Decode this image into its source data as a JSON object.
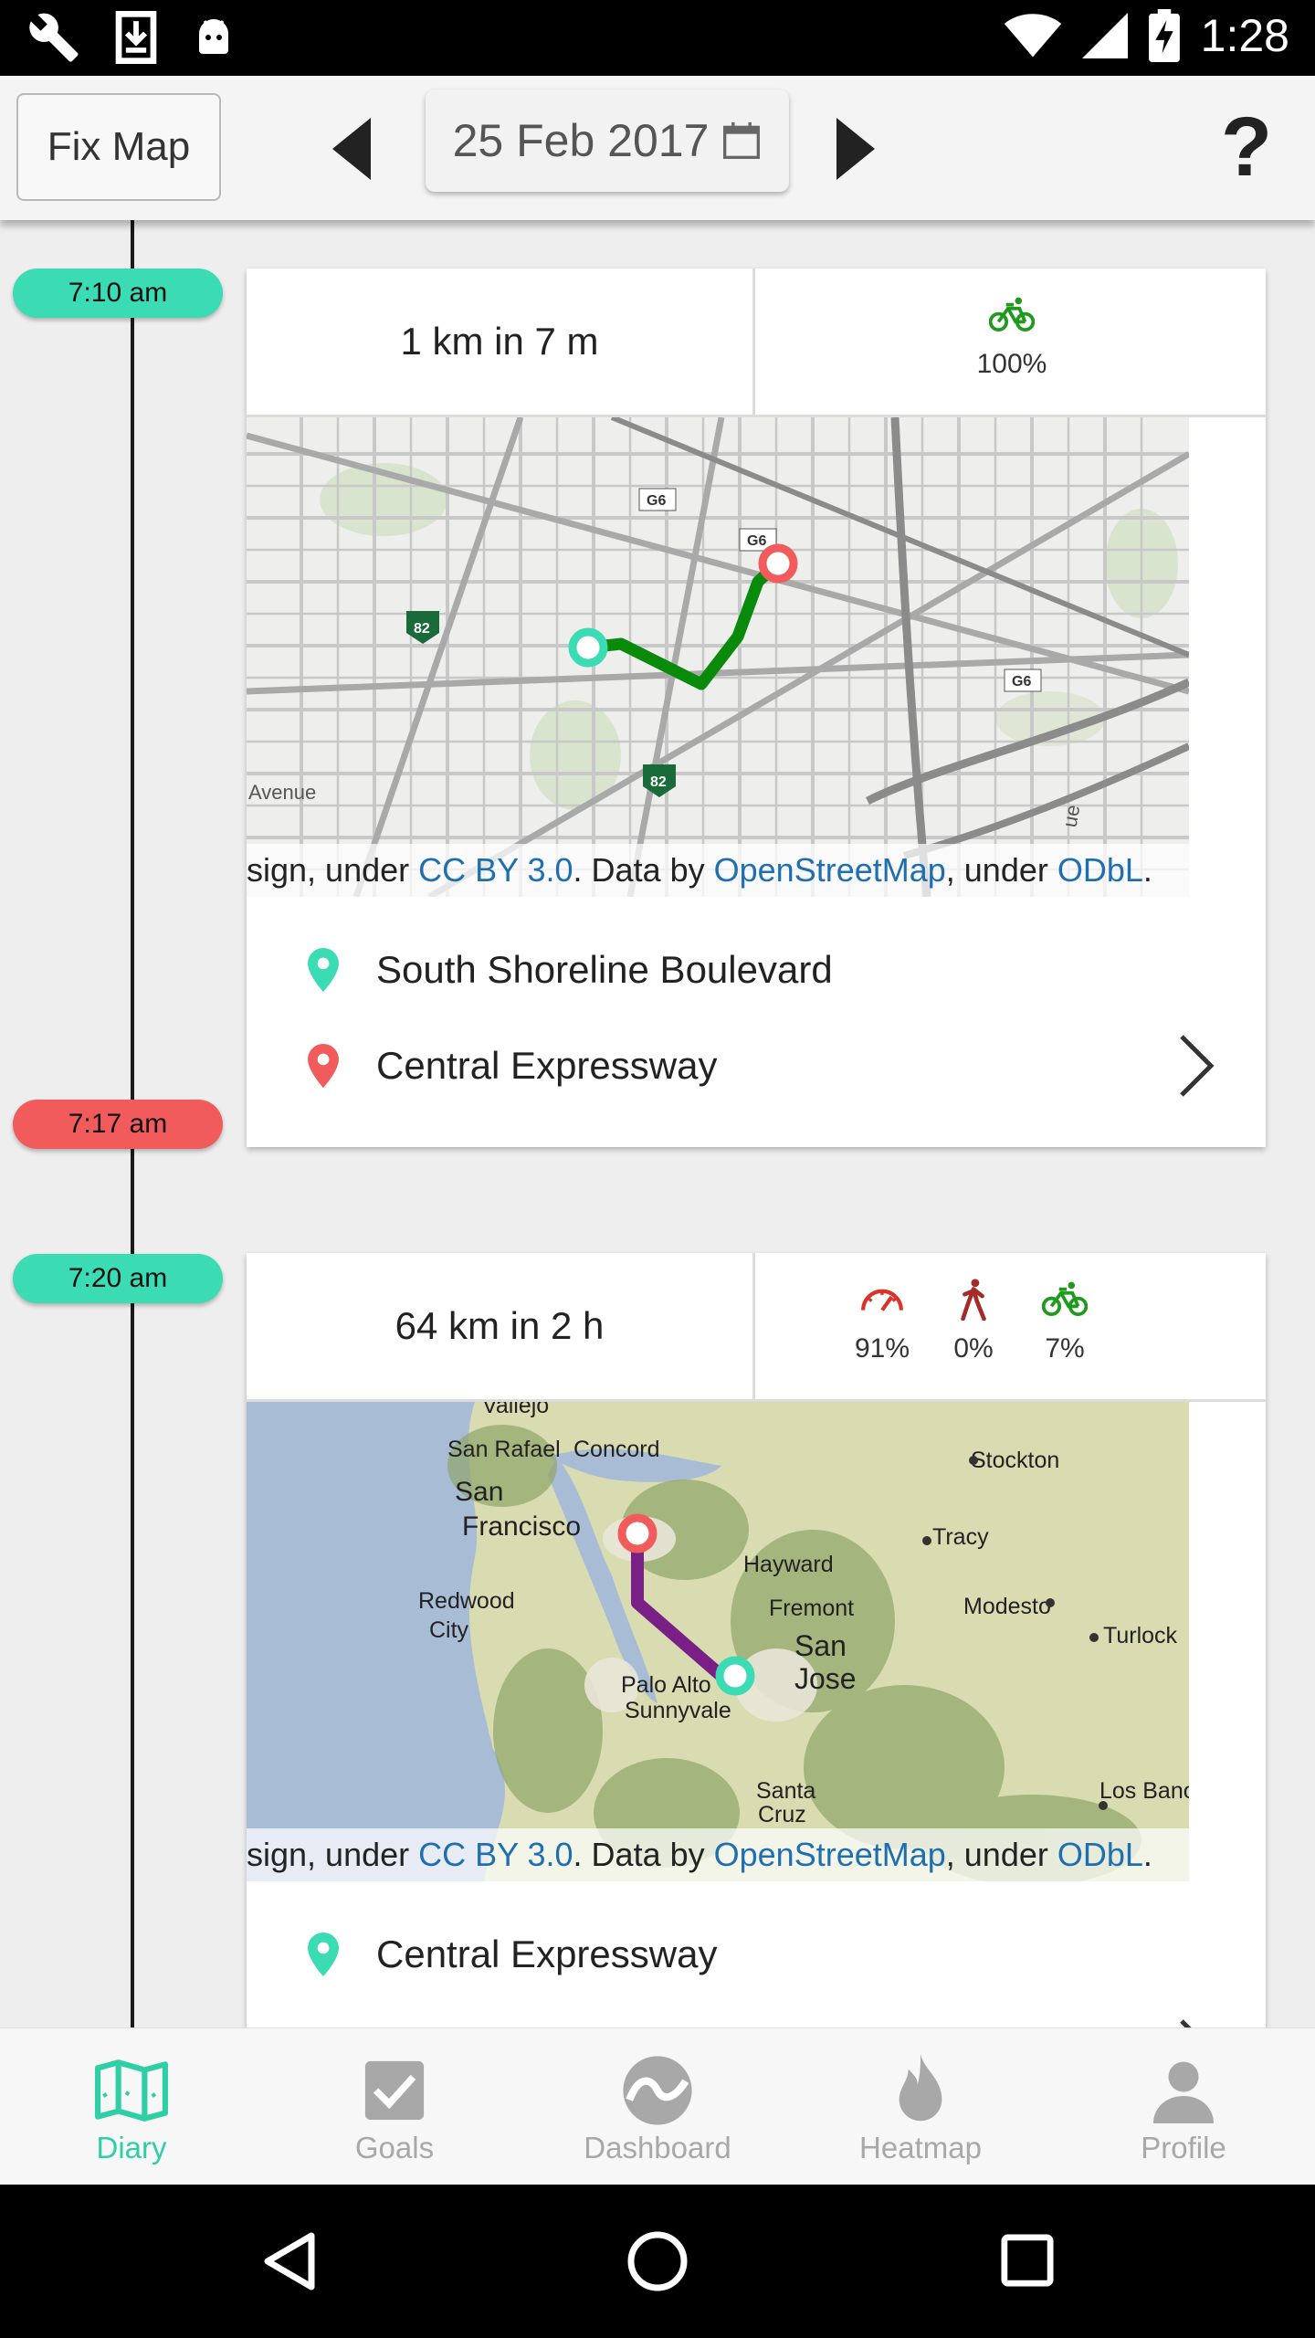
{
  "status_bar": {
    "time": "1:28",
    "left_icons": [
      "wrench-icon",
      "download-icon",
      "android-icon"
    ],
    "right_icons": [
      "wifi-icon",
      "signal-icon",
      "battery-charging-icon"
    ]
  },
  "toolbar": {
    "fix_map_label": "Fix Map",
    "date": "25 Feb 2017",
    "help_label": "?"
  },
  "trips": [
    {
      "start_time": "7:10 am",
      "end_time": "7:17 am",
      "summary": "1 km in 7 m",
      "modes": [
        {
          "icon": "bicycle-icon",
          "percent": "100%",
          "color": "#1f9a1f"
        }
      ],
      "route_color": "#0a8a0a",
      "attribution": {
        "pre": "sign, under ",
        "link1": "CC BY 3.0",
        "mid": ". Data by ",
        "link2": "OpenStreetMap",
        "mid2": ", under ",
        "link3": "ODbL",
        "post": "."
      },
      "start_place": "South Shoreline Boulevard",
      "end_place": "Central Expressway",
      "map_labels": [
        "G6",
        "G6",
        "G6",
        "82",
        "82",
        "Avenue",
        "ue"
      ]
    },
    {
      "start_time": "7:20 am",
      "summary": "64 km in 2 h",
      "modes": [
        {
          "icon": "speedometer-icon",
          "percent": "91%",
          "color": "#d9342b"
        },
        {
          "icon": "walking-icon",
          "percent": "0%",
          "color": "#a52a2a"
        },
        {
          "icon": "bicycle-icon",
          "percent": "7%",
          "color": "#1f9a1f"
        }
      ],
      "route_color": "#7a1f86",
      "attribution": {
        "pre": "sign, under ",
        "link1": "CC BY 3.0",
        "mid": ". Data by ",
        "link2": "OpenStreetMap",
        "mid2": ", under ",
        "link3": "ODbL",
        "post": "."
      },
      "start_place": "Central Expressway",
      "map_labels": [
        "Vallejo",
        "San Rafael",
        "Concord",
        "Stockton",
        "San",
        "Francisco",
        "Tracy",
        "Hayward",
        "Redwood",
        "City",
        "Fremont",
        "Modesto",
        "Turlock",
        "San",
        "Jose",
        "Palo Alto",
        "Sunnyvale",
        "Santa",
        "Cruz",
        "Los Banos"
      ]
    }
  ],
  "bottom_nav": [
    {
      "label": "Diary",
      "icon": "map-icon",
      "active": true
    },
    {
      "label": "Goals",
      "icon": "checkbox-icon",
      "active": false
    },
    {
      "label": "Dashboard",
      "icon": "dashboard-icon",
      "active": false
    },
    {
      "label": "Heatmap",
      "icon": "flame-icon",
      "active": false
    },
    {
      "label": "Profile",
      "icon": "person-icon",
      "active": false
    }
  ],
  "colors": {
    "accent": "#2fcfa6",
    "start_pill": "#3bdbb3",
    "end_pill": "#f25b5b",
    "link": "#1f6fb0"
  }
}
